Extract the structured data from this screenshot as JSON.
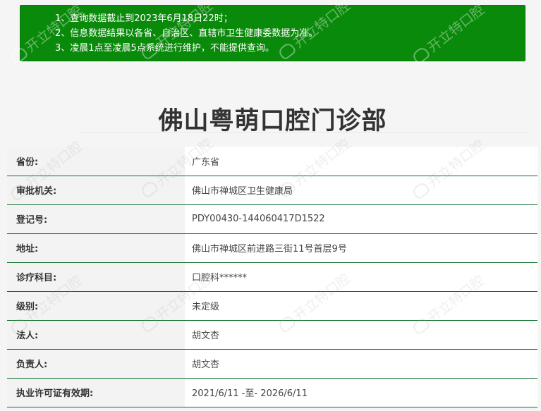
{
  "notice": {
    "lines": [
      "1、查询数据截止到2023年6月18日22时；",
      "2、信息数据结果以各省、自治区、直辖市卫生健康委数据为准。",
      "3、凌晨1点至凌晨5点系统进行维护，不能提供查询。"
    ]
  },
  "page_title": "佛山粤萌口腔门诊部",
  "rows": [
    {
      "label": "省份:",
      "value": "广东省"
    },
    {
      "label": "审批机关:",
      "value": "佛山市禅城区卫生健康局"
    },
    {
      "label": "登记号:",
      "value": "PDY00430-144060417D1522"
    },
    {
      "label": "地址:",
      "value": "佛山市禅城区前进路三街11号首层9号"
    },
    {
      "label": "诊疗科目:",
      "value": "口腔科******"
    },
    {
      "label": "级别:",
      "value": "未定级"
    },
    {
      "label": "法人:",
      "value": "胡文杏"
    },
    {
      "label": "负责人:",
      "value": "胡文杏"
    },
    {
      "label": "执业许可证有效期:",
      "value": "2021/6/11 -至- 2026/6/11"
    }
  ],
  "watermark": {
    "text": "开立特口腔"
  }
}
